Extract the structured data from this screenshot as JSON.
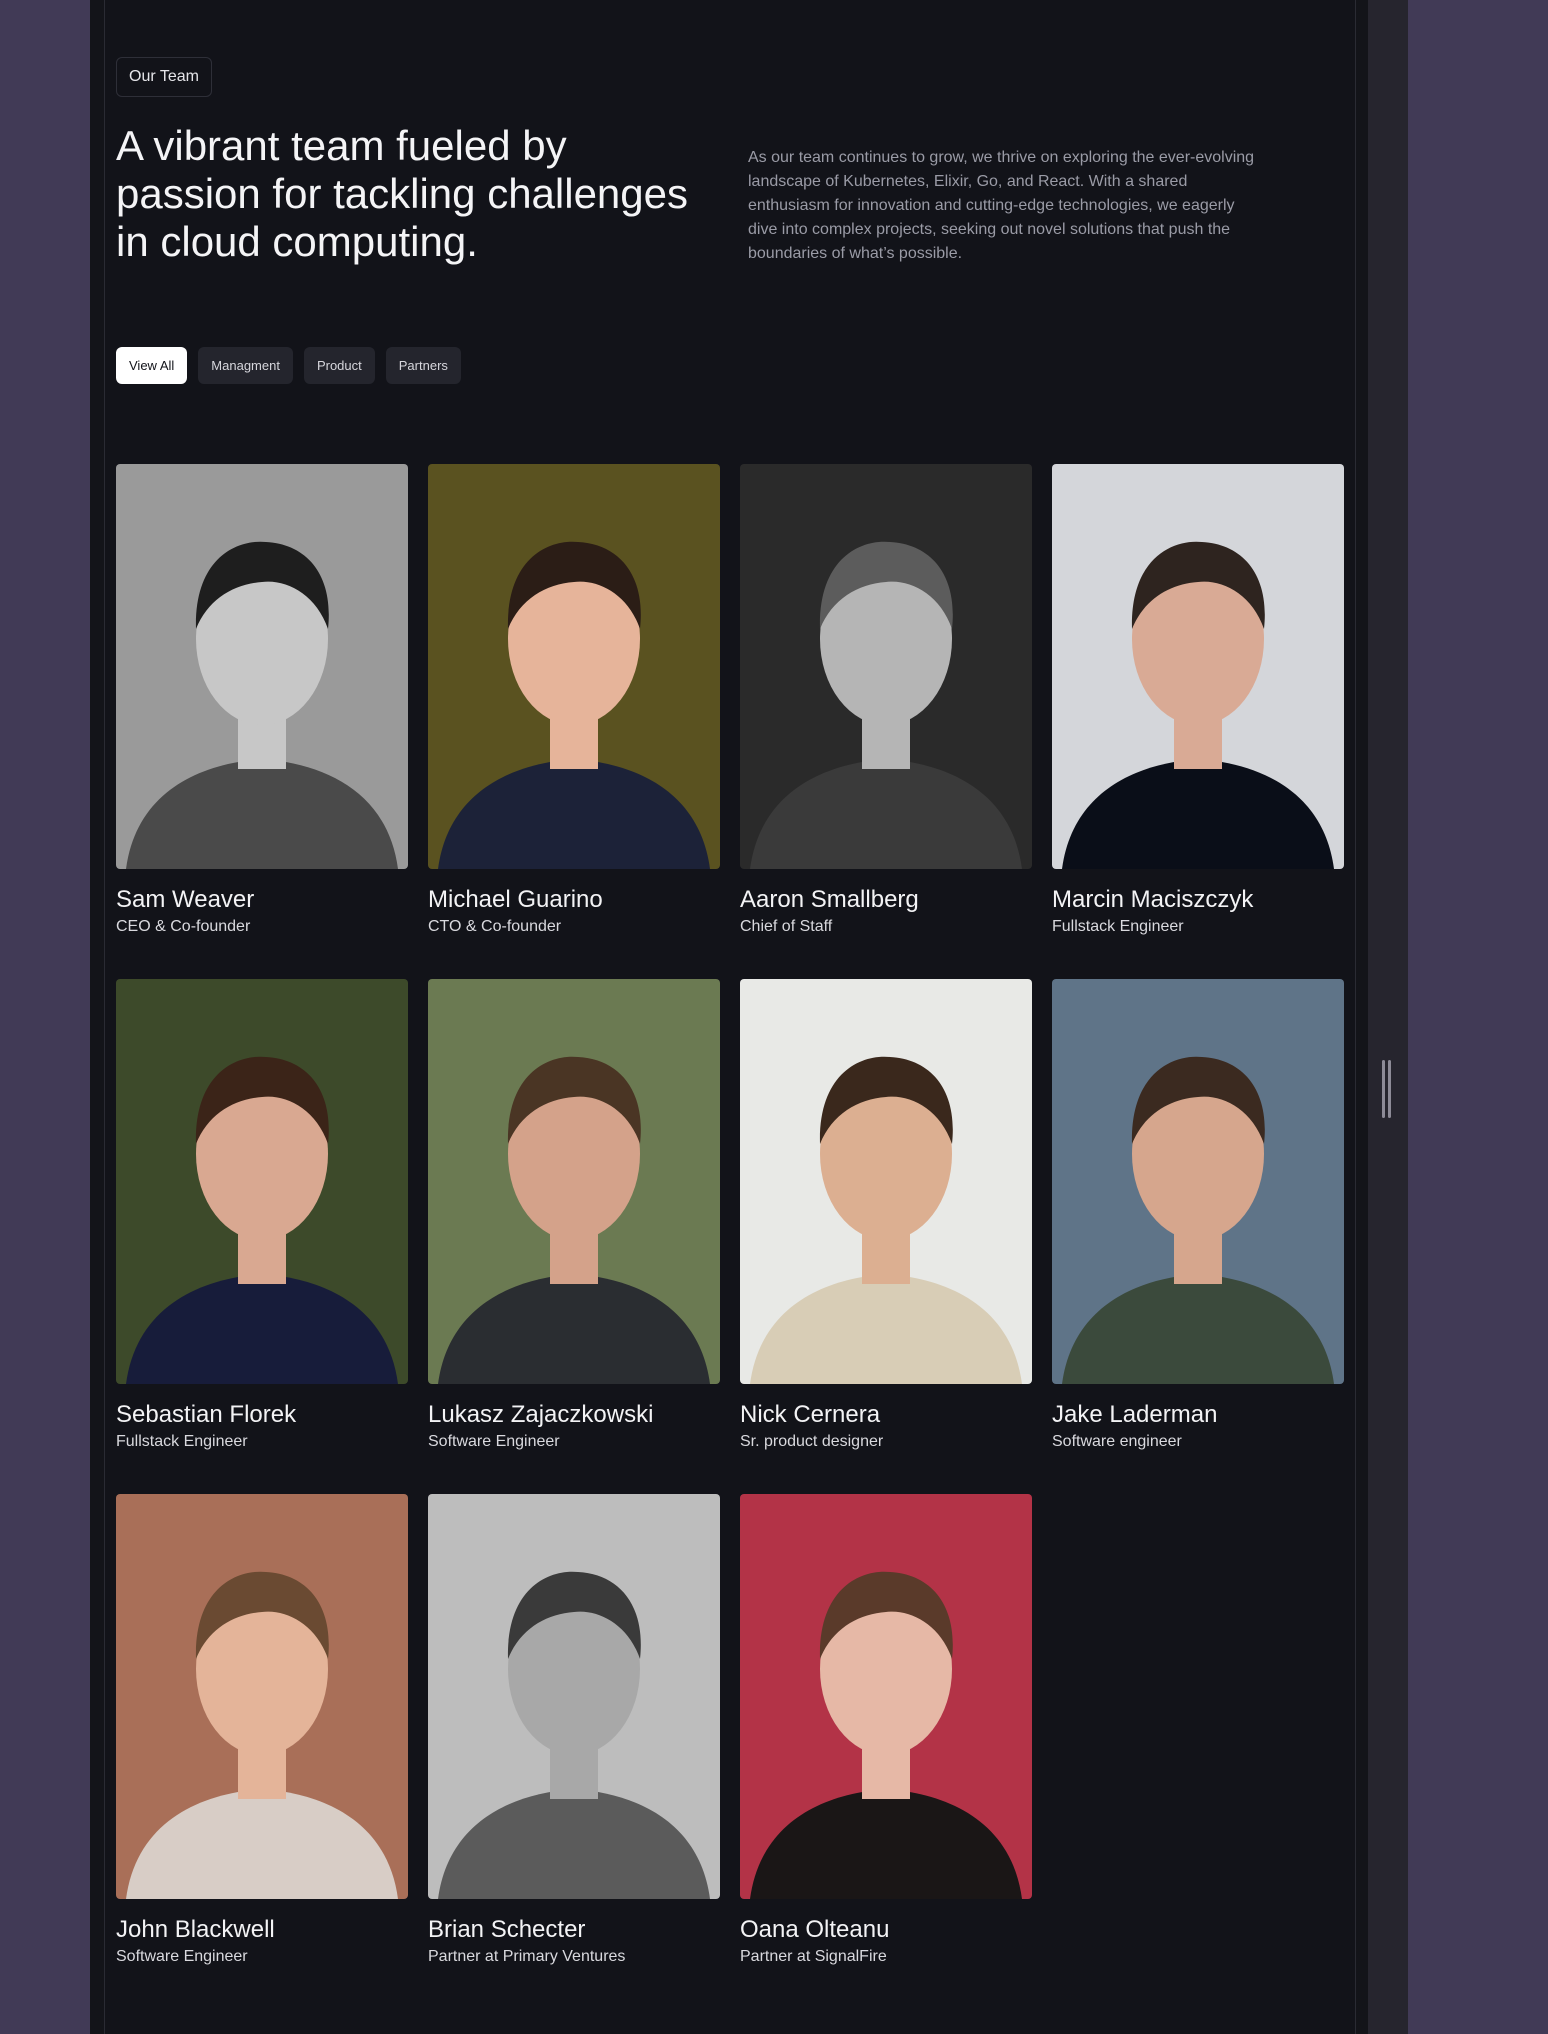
{
  "section": {
    "badge": "Our Team",
    "headline": "A vibrant team fueled by passion for tackling challenges in cloud computing.",
    "intro": "As our team continues to grow, we thrive on exploring the ever-evolving landscape of Kubernetes, Elixir, Go, and React. With a shared enthusiasm for innovation and cutting-edge technologies, we eagerly dive into complex projects, seeking out novel solutions that push the boundaries of what’s possible."
  },
  "filters": [
    {
      "label": "View All",
      "active": true
    },
    {
      "label": "Managment",
      "active": false
    },
    {
      "label": "Product",
      "active": false
    },
    {
      "label": "Partners",
      "active": false
    }
  ],
  "team": [
    {
      "name": "Sam Weaver",
      "role": "CEO & Co-founder",
      "bg": "#9a9a9a",
      "skin": "#c7c7c7",
      "hair": "#1e1e1e",
      "shirt": "#4a4a4a"
    },
    {
      "name": "Michael Guarino",
      "role": "CTO & Co-founder",
      "bg": "#5a5220",
      "skin": "#e6b49a",
      "hair": "#2b1d16",
      "shirt": "#1c2238"
    },
    {
      "name": "Aaron Smallberg",
      "role": "Chief of Staff",
      "bg": "#2a2a2a",
      "skin": "#b5b5b5",
      "hair": "#5c5c5c",
      "shirt": "#3a3a3a"
    },
    {
      "name": "Marcin Maciszczyk",
      "role": "Fullstack Engineer",
      "bg": "#d4d6da",
      "skin": "#d9aa95",
      "hair": "#2e241f",
      "shirt": "#0a0e18"
    },
    {
      "name": "Sebastian Florek",
      "role": "Fullstack Engineer",
      "bg": "#3d4a2a",
      "skin": "#d9a891",
      "hair": "#3b2418",
      "shirt": "#171c3a"
    },
    {
      "name": "Lukasz Zajaczkowski",
      "role": "Software Engineer",
      "bg": "#6b7a52",
      "skin": "#d4a28a",
      "hair": "#4a3524",
      "shirt": "#2a2d31"
    },
    {
      "name": "Nick Cernera",
      "role": "Sr. product designer",
      "bg": "#e8e9e6",
      "skin": "#dcaf91",
      "hair": "#3a281c",
      "shirt": "#d8cdb6"
    },
    {
      "name": "Jake Laderman",
      "role": "Software engineer",
      "bg": "#5f7488",
      "skin": "#d6a68d",
      "hair": "#3b2a20",
      "shirt": "#3b4a3c"
    },
    {
      "name": "John Blackwell",
      "role": "Software Engineer",
      "bg": "#a96f58",
      "skin": "#e4b499",
      "hair": "#6a4a32",
      "shirt": "#d8cdc6"
    },
    {
      "name": "Brian Schecter",
      "role": "Partner at Primary Ventures",
      "bg": "#bdbdbd",
      "skin": "#a8a8a8",
      "hair": "#3a3a3a",
      "shirt": "#5b5b5b"
    },
    {
      "name": "Oana Olteanu",
      "role": "Partner at SignalFire",
      "bg": "#b33347",
      "skin": "#e6b8a6",
      "hair": "#5a3a2a",
      "shirt": "#1a1616"
    }
  ]
}
